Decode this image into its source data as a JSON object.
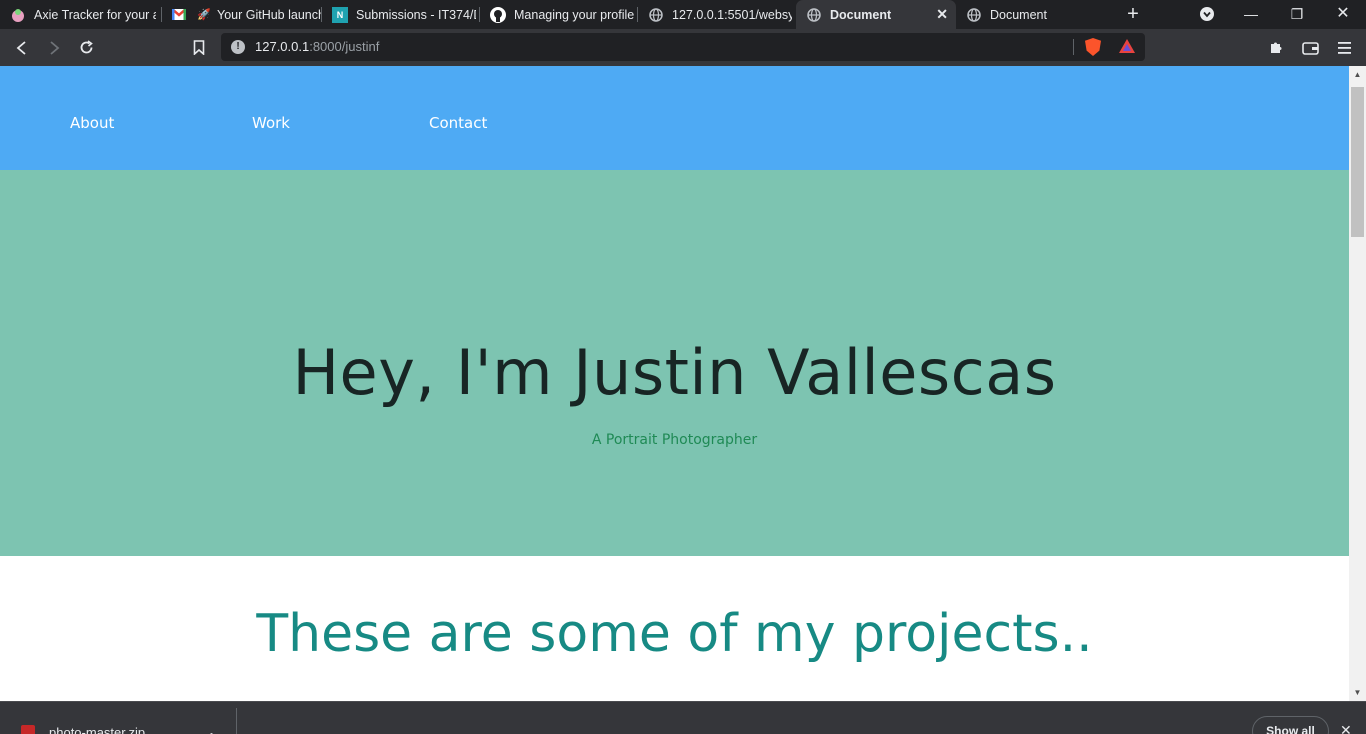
{
  "browser": {
    "tabs": [
      {
        "title": "Axie Tracker for your ac",
        "icon": "axie-favicon"
      },
      {
        "title": "",
        "icon": "gmail-icon"
      },
      {
        "title": "Your GitHub launch",
        "icon": "rocket-icon"
      },
      {
        "title": "Submissions - IT374/D",
        "icon": "notion-icon"
      },
      {
        "title": "Managing your profile",
        "icon": "github-icon"
      },
      {
        "title": "127.0.0.1:5501/websys/",
        "icon": "globe-icon"
      },
      {
        "title": "Document",
        "icon": "globe-icon",
        "active": true
      },
      {
        "title": "Document",
        "icon": "globe-icon"
      }
    ],
    "address": {
      "host": "127.0.0.1",
      "path": ":8000/justinf"
    },
    "accent": "#4eaaf4"
  },
  "page": {
    "nav": {
      "about": "About",
      "work": "Work",
      "contact": "Contact"
    },
    "hero": {
      "title": "Hey, I'm Justin Vallescas",
      "subtitle": "A Portrait Photographer"
    },
    "projects_title": "These are some of my projects.."
  },
  "downloads": {
    "file": "photo-master.zip",
    "show_all": "Show all"
  },
  "colors": {
    "navbar": "#4eaaf4",
    "hero": "#7dc4b1",
    "projects_title": "#178a84",
    "subtitle": "#1f8a55"
  }
}
